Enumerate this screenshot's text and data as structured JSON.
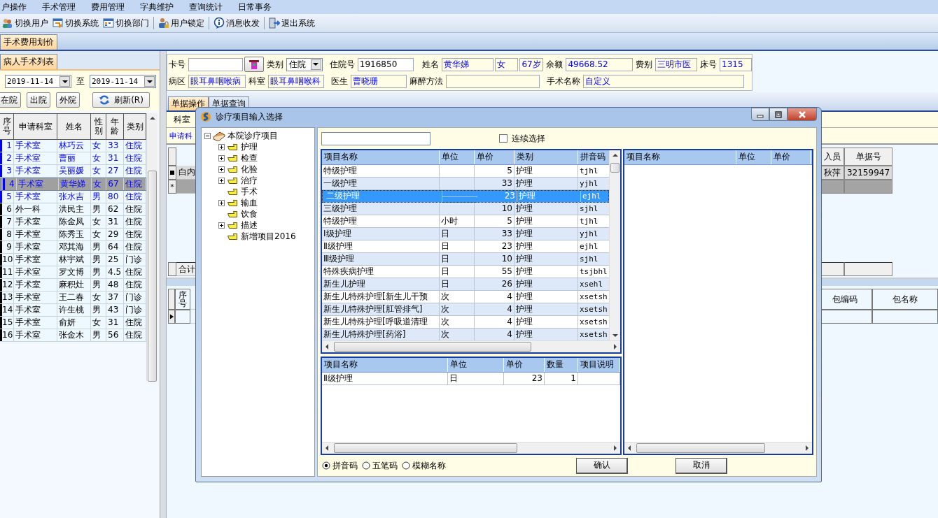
{
  "menu": [
    "户操作",
    "手术管理",
    "费用管理",
    "字典维护",
    "查询统计",
    "日常事务"
  ],
  "toolbar": [
    {
      "label": "切换用户",
      "kind": "users"
    },
    {
      "label": "切换系统",
      "kind": "switch"
    },
    {
      "label": "切换部门",
      "kind": "calendar"
    },
    {
      "label": "用户锁定",
      "kind": "lock"
    },
    {
      "label": "消息收发",
      "kind": "info"
    },
    {
      "label": "退出系统",
      "kind": "exit"
    }
  ],
  "tabs": [
    {
      "label": "手术费用划价",
      "selected": true
    }
  ],
  "patient_list": {
    "tab": "病人手术列表",
    "date_from": "2019-11-14",
    "date_to_label": "至",
    "date_to": "2019-11-14",
    "filter_buttons": [
      "在院",
      "出院",
      "外院"
    ],
    "refresh_button": "刷新(R)",
    "columns": [
      "序号",
      "申请科室",
      "姓名",
      "性别",
      "年龄",
      "类别"
    ],
    "rows": [
      {
        "no": "1",
        "dept": "手术室",
        "name": "林巧云",
        "sex": "女",
        "age": "33",
        "type": "住院",
        "color": "#0000ff",
        "selected": false
      },
      {
        "no": "2",
        "dept": "手术室",
        "name": "曹丽",
        "sex": "女",
        "age": "31",
        "type": "住院",
        "color": "#0000ff",
        "selected": false
      },
      {
        "no": "3",
        "dept": "手术室",
        "name": "吴丽媛",
        "sex": "女",
        "age": "27",
        "type": "住院",
        "color": "#0000ff",
        "selected": false
      },
      {
        "no": "4",
        "dept": "手术室",
        "name": "黄华娣",
        "sex": "女",
        "age": "67",
        "type": "住院",
        "color": "#0000ff",
        "selected": true
      },
      {
        "no": "5",
        "dept": "手术室",
        "name": "张水吉",
        "sex": "男",
        "age": "80",
        "type": "住院",
        "color": "#0000ff",
        "selected": false
      },
      {
        "no": "6",
        "dept": "外一科",
        "name": "洪民主",
        "sex": "男",
        "age": "62",
        "type": "住院",
        "color": "#000000",
        "selected": false
      },
      {
        "no": "7",
        "dept": "手术室",
        "name": "陈金凤",
        "sex": "女",
        "age": "31",
        "type": "住院",
        "color": "#000000",
        "selected": false
      },
      {
        "no": "8",
        "dept": "手术室",
        "name": "陈秀玉",
        "sex": "女",
        "age": "29",
        "type": "住院",
        "color": "#000000",
        "selected": false
      },
      {
        "no": "9",
        "dept": "手术室",
        "name": "邓其海",
        "sex": "男",
        "age": "64",
        "type": "住院",
        "color": "#000000",
        "selected": false
      },
      {
        "no": "10",
        "dept": "手术室",
        "name": "林宇斌",
        "sex": "男",
        "age": "25",
        "type": "门诊",
        "color": "#000000",
        "selected": false
      },
      {
        "no": "11",
        "dept": "手术室",
        "name": "罗文博",
        "sex": "男",
        "age": "4.5",
        "type": "住院",
        "color": "#000000",
        "selected": false
      },
      {
        "no": "12",
        "dept": "手术室",
        "name": "麻积灶",
        "sex": "男",
        "age": "48",
        "type": "住院",
        "color": "#000000",
        "selected": false
      },
      {
        "no": "13",
        "dept": "手术室",
        "name": "王二春",
        "sex": "女",
        "age": "37",
        "type": "门诊",
        "color": "#000000",
        "selected": false
      },
      {
        "no": "14",
        "dept": "手术室",
        "name": "许生桃",
        "sex": "男",
        "age": "43",
        "type": "门诊",
        "color": "#000000",
        "selected": false
      },
      {
        "no": "15",
        "dept": "手术室",
        "name": "俞妍",
        "sex": "女",
        "age": "31",
        "type": "住院",
        "color": "#000000",
        "selected": false
      },
      {
        "no": "16",
        "dept": "手术室",
        "name": "张金木",
        "sex": "男",
        "age": "56",
        "type": "住院",
        "color": "#000000",
        "selected": false
      }
    ]
  },
  "patient": {
    "card_no_label": "卡号",
    "category_label": "类别",
    "category": "住院",
    "inpatient_no_label": "住院号",
    "inpatient_no": "1916850",
    "name_label": "姓名",
    "name": "黄华娣",
    "sex": "女",
    "age": "67岁",
    "balance_label": "余额",
    "balance": "49668.52",
    "fee_type_label": "费别",
    "fee_type": "三明市医",
    "bed_label": "床号",
    "bed": "1315",
    "ward_label": "病区",
    "ward": "眼耳鼻咽喉病",
    "dept_label": "科室",
    "dept": "眼耳鼻咽喉科",
    "doctor_label": "医生",
    "doctor": "曹晓珊",
    "anesthesia_label": "麻醉方法",
    "surgery_name_label": "手术名称",
    "surgery_name": "自定义"
  },
  "doc_tabs": [
    {
      "label": "单据操作",
      "selected": true
    },
    {
      "label": "单据查询",
      "selected": false
    }
  ],
  "document": {
    "dept_label": "科室",
    "apply_label": "申请科",
    "row_text": "白内",
    "new_row_marker": "*",
    "recorder_header": "入员",
    "doc_no_header": "单据号",
    "recorder": "秋萍",
    "doc_no": "32159947",
    "total_label": "合计",
    "seq_header": "序号",
    "pack_code_header": "包编码",
    "pack_name_header": "包名称"
  },
  "dialog": {
    "title": "诊疗项目输入选择",
    "tree": {
      "label": "本院诊疗项目",
      "expanded": true,
      "children": [
        {
          "label": "护理",
          "kind": "group"
        },
        {
          "label": "检查",
          "kind": "group"
        },
        {
          "label": "化验",
          "kind": "group"
        },
        {
          "label": "治疗",
          "kind": "group"
        },
        {
          "label": "手术",
          "kind": "leaf"
        },
        {
          "label": "输血",
          "kind": "group"
        },
        {
          "label": "饮食",
          "kind": "leaf"
        },
        {
          "label": "描述",
          "kind": "group"
        },
        {
          "label": "新增项目2016",
          "kind": "leaf"
        }
      ]
    },
    "continuous": {
      "label": "连续选择",
      "checked": false
    },
    "items": {
      "columns": [
        "项目名称",
        "单位",
        "单价",
        "类别",
        "拼音码"
      ],
      "rows": [
        {
          "name": "特级护理",
          "price": "5",
          "type": "护理",
          "code": "tjhl",
          "selected": false
        },
        {
          "name": "一级护理",
          "price": "33",
          "type": "护理",
          "code": "yjhl",
          "selected": false
        },
        {
          "name": "二级护理",
          "price": "23",
          "type": "护理",
          "code": "ejhl",
          "selected": true
        },
        {
          "name": "三级护理",
          "price": "10",
          "type": "护理",
          "code": "sjhl",
          "selected": false
        },
        {
          "name": "特级护理",
          "unit": "小时",
          "price": "5",
          "type": "护理",
          "code": "tjhl",
          "selected": false
        },
        {
          "name": "Ⅰ级护理",
          "unit": "日",
          "price": "33",
          "type": "护理",
          "code": "yjhl",
          "selected": false
        },
        {
          "name": "Ⅱ级护理",
          "unit": "日",
          "price": "23",
          "type": "护理",
          "code": "ejhl",
          "selected": false
        },
        {
          "name": "Ⅲ级护理",
          "unit": "日",
          "price": "10",
          "type": "护理",
          "code": "sjhl",
          "selected": false
        },
        {
          "name": "特殊疾病护理",
          "unit": "日",
          "price": "55",
          "type": "护理",
          "code": "tsjbhl",
          "selected": false
        },
        {
          "name": "新生儿护理",
          "unit": "日",
          "price": "26",
          "type": "护理",
          "code": "xsehl",
          "selected": false
        },
        {
          "name": "新生儿特殊护理[新生儿干预",
          "unit": "次",
          "price": "4",
          "type": "护理",
          "code": "xsetsh",
          "selected": false
        },
        {
          "name": "新生儿特殊护理[肛管排气]",
          "unit": "次",
          "price": "4",
          "type": "护理",
          "code": "xsetsh",
          "selected": false
        },
        {
          "name": "新生儿特殊护理[呼吸道清理",
          "unit": "次",
          "price": "4",
          "type": "护理",
          "code": "xsetsh",
          "selected": false
        },
        {
          "name": "新生儿特殊护理[药浴]",
          "unit": "次",
          "price": "4",
          "type": "护理",
          "code": "xsetsh",
          "selected": false
        }
      ]
    },
    "chosen": {
      "columns": [
        "项目名称",
        "单位",
        "单价",
        "数量",
        "项目说明"
      ],
      "rows": [
        {
          "name": "Ⅱ级护理",
          "unit": "日",
          "price": "23",
          "qty": "1"
        }
      ]
    },
    "selected_list": {
      "columns": [
        "项目名称",
        "单位",
        "单价"
      ]
    },
    "search_modes": [
      {
        "label": "拼音码",
        "selected": true
      },
      {
        "label": "五笔码",
        "selected": false
      },
      {
        "label": "模糊名称",
        "selected": false
      }
    ],
    "buttons": [
      "确认",
      "取消"
    ]
  }
}
